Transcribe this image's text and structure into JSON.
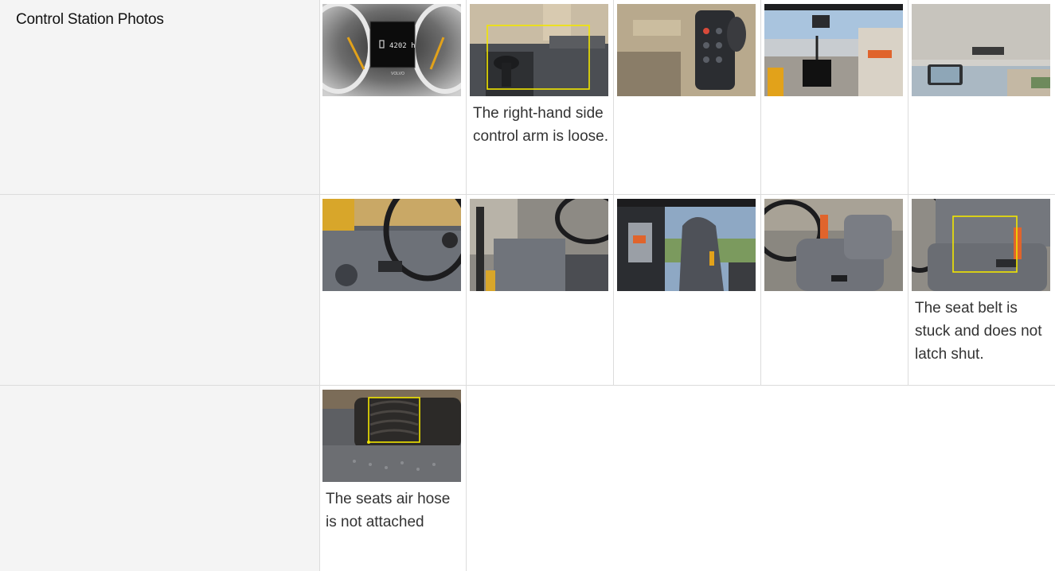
{
  "section": {
    "title": "Control Station Photos"
  },
  "rows": [
    {
      "photos": [
        {
          "name": "dashboard-hour-meter-photo",
          "overlay": "4202 h",
          "brand": "VOLVO",
          "caption": ""
        },
        {
          "name": "right-hand-control-arm-photo",
          "caption": "The right-hand side control arm is loose."
        },
        {
          "name": "control-panel-photo",
          "caption": ""
        },
        {
          "name": "cab-monitor-photo",
          "caption": ""
        },
        {
          "name": "cab-ceiling-mirrors-photo",
          "caption": ""
        }
      ]
    },
    {
      "photos": [
        {
          "name": "steering-wheel-dash-photo",
          "caption": ""
        },
        {
          "name": "steering-column-photo",
          "caption": ""
        },
        {
          "name": "operator-seat-photo",
          "caption": ""
        },
        {
          "name": "seat-side-photo",
          "caption": ""
        },
        {
          "name": "seat-belt-photo",
          "caption": "The seat belt is stuck and does not latch shut."
        }
      ]
    },
    {
      "photos": [
        {
          "name": "seat-air-hose-photo",
          "caption": "The seats air hose is not attached"
        }
      ]
    }
  ],
  "colors": {
    "highlight_box": "#f2e600",
    "label_bg": "#f4f4f4",
    "border": "#dcdcdc"
  }
}
